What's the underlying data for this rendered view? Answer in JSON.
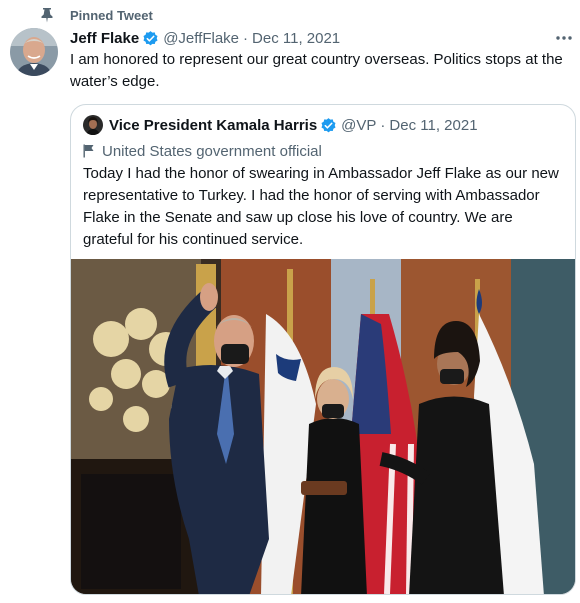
{
  "pinned": {
    "label": "Pinned Tweet",
    "icon": "pin-icon"
  },
  "tweet": {
    "display_name": "Jeff Flake",
    "handle": "@JeffFlake",
    "separator": "·",
    "date": "Dec 11, 2021",
    "text": "I am honored to represent our great country overseas. Politics stops at the water’s edge.",
    "verified_icon": "verified-badge-icon",
    "more_icon": "more-icon"
  },
  "quote": {
    "display_name": "Vice President Kamala Harris",
    "handle": "@VP",
    "separator": "·",
    "date": "Dec 11, 2021",
    "affiliation": "United States government official",
    "affiliation_icon": "flag-icon",
    "text": "Today I had the honor of swearing in Ambassador Jeff Flake as our new representative to Turkey. I had the honor of serving with Ambassador Flake in the Senate and saw up close his love of country. We are grateful for his continued service."
  },
  "colors": {
    "accent": "#1d9bf0",
    "text_primary": "#0f1419",
    "text_secondary": "#536471",
    "border": "#cfd9de"
  }
}
